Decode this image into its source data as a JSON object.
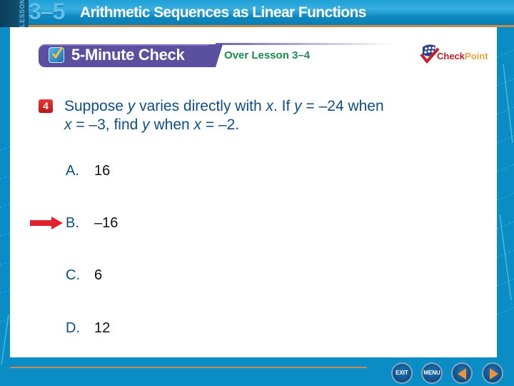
{
  "header": {
    "lesson_word": "LESSON",
    "lesson_number": "3–5",
    "lesson_title": "Arithmetic Sequences as Linear Functions"
  },
  "check_bar": {
    "icon": "checkbox-icon",
    "label": "5-Minute Check",
    "over_lesson": "Over Lesson 3–4"
  },
  "logo": {
    "part1": "Check",
    "part2": "Point",
    "colors": {
      "check": "#c81e2a",
      "point": "#e8a53a"
    }
  },
  "question": {
    "number": "4",
    "parts": [
      "Suppose ",
      "y",
      " varies directly with ",
      "x",
      ". If ",
      "y",
      " = –24 when ",
      "x",
      " = –3, find ",
      "y",
      " when ",
      "x",
      " = –2."
    ]
  },
  "answers": [
    {
      "letter": "A.",
      "value": "16",
      "correct": false
    },
    {
      "letter": "B.",
      "value": "–16",
      "correct": true
    },
    {
      "letter": "C.",
      "value": "6",
      "correct": false
    },
    {
      "letter": "D.",
      "value": "12",
      "correct": false
    }
  ],
  "nav": {
    "exit_label": "EXIT",
    "menu_label": "MENU",
    "prev_icon": "previous-arrow-icon",
    "next_icon": "next-arrow-icon"
  },
  "colors": {
    "brand_blue": "#0a8cc4",
    "check_bar": "#5b4fa0",
    "question_text": "#0d4e86",
    "over_lesson_text": "#1a8a4e",
    "correct_arrow": "#e0232b",
    "accent_rule": "#c98a4a"
  }
}
